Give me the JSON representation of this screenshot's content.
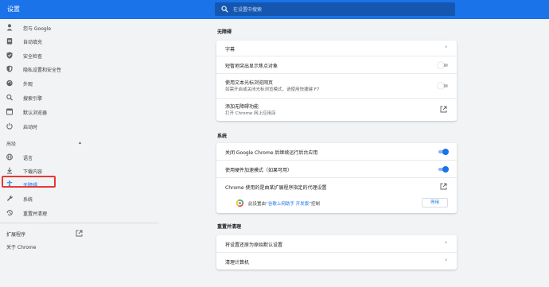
{
  "app": {
    "title": "设置"
  },
  "search": {
    "placeholder": "在设置中搜索"
  },
  "sidebar": {
    "items": [
      {
        "label": "您与 Google"
      },
      {
        "label": "自动填充"
      },
      {
        "label": "安全检查"
      },
      {
        "label": "隐私设置和安全性"
      },
      {
        "label": "外观"
      },
      {
        "label": "搜索引擎"
      },
      {
        "label": "默认浏览器"
      },
      {
        "label": "启动时"
      }
    ],
    "advanced_label": "高级",
    "advanced_items": [
      {
        "label": "语言"
      },
      {
        "label": "下载内容"
      },
      {
        "label": "无障碍"
      },
      {
        "label": "系统"
      },
      {
        "label": "重置并清理"
      }
    ],
    "extensions_label": "扩展程序",
    "about_label": "关于 Chrome"
  },
  "accessibility": {
    "title": "无障碍",
    "captions": "字幕",
    "focus_highlight": "短暂地突出显示焦点对象",
    "caret_browsing": "使用文本光标浏览网页",
    "caret_browsing_desc": "如需开启或关闭光标浏览模式，请使用快捷键 F7",
    "add_features": "添加无障碍功能",
    "add_features_desc": "打开 Chrome 网上应用店"
  },
  "system": {
    "title": "系统",
    "background_apps": "关闭 Google Chrome 后继续运行后台应用",
    "hardware_accel": "使用硬件加速模式（如果可用）",
    "proxy": "Chrome 使用的是由某扩展程序指定的代理设置",
    "policy_prefix": "此设置由",
    "policy_link": "“谷歌上网助手 开发版”",
    "policy_suffix": "控制",
    "policy_button": "停用"
  },
  "reset": {
    "title": "重置并清理",
    "restore": "将设置还原为原始默认设置",
    "cleanup": "清理计算机"
  },
  "toggles": {
    "focus_highlight": false,
    "caret_browsing": false,
    "background_apps": true,
    "hardware_accel": true
  },
  "colors": {
    "accent": "#1a73e8",
    "highlight_box": "#e53935"
  }
}
